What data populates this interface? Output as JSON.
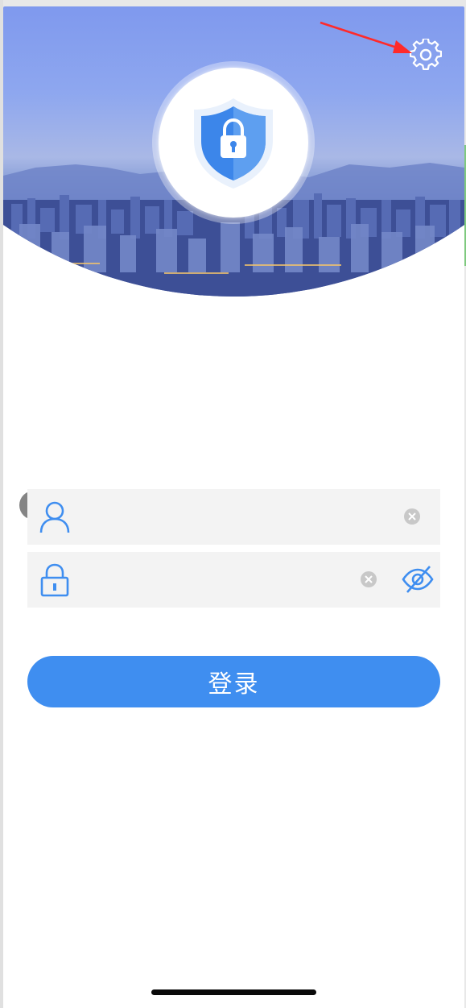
{
  "app": {
    "screen": "login"
  },
  "icons": {
    "settings": "gear-icon",
    "logo": "shield-lock-icon",
    "username": "user-icon",
    "password": "lock-icon",
    "clear": "clear-icon",
    "visibility": "eye-off-icon",
    "back": "chevron-left-icon"
  },
  "form": {
    "username": {
      "value": "",
      "placeholder": ""
    },
    "password": {
      "value": "",
      "placeholder": ""
    },
    "login_label": "登录"
  },
  "colors": {
    "primary": "#3f8ef0",
    "icon_blue": "#3f8ef0",
    "field_bg": "#f3f3f3",
    "annotation_arrow": "#ff2a2a"
  }
}
